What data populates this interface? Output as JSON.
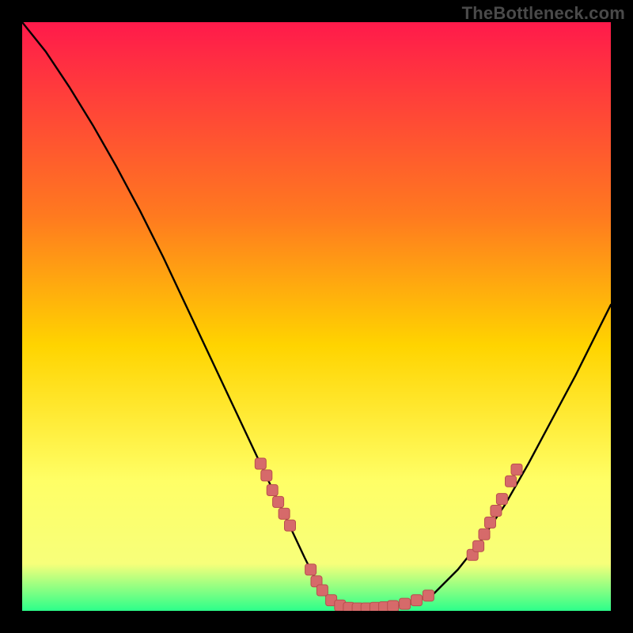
{
  "watermark": "TheBottleneck.com",
  "colors": {
    "gradient_top": "#ff1a4b",
    "gradient_mid_upper": "#ff7a1f",
    "gradient_mid": "#ffd400",
    "gradient_lower": "#f7ff7a",
    "gradient_bottom_yellow": "#ffff66",
    "gradient_bottom_green": "#2cff8a",
    "curve": "#000000",
    "marker_fill": "#d66a6a",
    "marker_stroke": "#b94e4e",
    "bg": "#000000"
  },
  "chart_data": {
    "type": "line",
    "title": "",
    "xlabel": "",
    "ylabel": "",
    "xlim": [
      0,
      100
    ],
    "ylim": [
      0,
      100
    ],
    "grid": false,
    "legend": false,
    "series": [
      {
        "name": "bottleneck-curve",
        "x": [
          0,
          4,
          8,
          12,
          16,
          20,
          24,
          28,
          32,
          36,
          40,
          44,
          48,
          50,
          52,
          54,
          56,
          58,
          62,
          66,
          70,
          74,
          78,
          82,
          86,
          90,
          94,
          98,
          100
        ],
        "y": [
          100,
          95,
          89,
          82.5,
          75.5,
          68,
          60,
          51.5,
          43,
          34.5,
          26,
          17.5,
          9,
          5,
          2,
          0.8,
          0.4,
          0.4,
          0.6,
          1.2,
          3,
          7,
          12,
          18,
          25,
          32.5,
          40,
          48,
          52
        ]
      }
    ],
    "markers": [
      {
        "name": "left-cluster",
        "points": [
          {
            "x": 40.5,
            "y": 25.0
          },
          {
            "x": 41.5,
            "y": 23.0
          },
          {
            "x": 42.5,
            "y": 20.5
          },
          {
            "x": 43.5,
            "y": 18.5
          },
          {
            "x": 44.5,
            "y": 16.5
          },
          {
            "x": 45.5,
            "y": 14.5
          }
        ]
      },
      {
        "name": "bottom-cluster",
        "points": [
          {
            "x": 49.0,
            "y": 7.0
          },
          {
            "x": 50.0,
            "y": 5.0
          },
          {
            "x": 51.0,
            "y": 3.5
          },
          {
            "x": 52.5,
            "y": 1.8
          },
          {
            "x": 54.0,
            "y": 0.9
          },
          {
            "x": 55.5,
            "y": 0.5
          },
          {
            "x": 57.0,
            "y": 0.4
          },
          {
            "x": 58.5,
            "y": 0.4
          },
          {
            "x": 60.0,
            "y": 0.5
          },
          {
            "x": 61.5,
            "y": 0.6
          },
          {
            "x": 63.0,
            "y": 0.8
          },
          {
            "x": 65.0,
            "y": 1.2
          },
          {
            "x": 67.0,
            "y": 1.8
          },
          {
            "x": 69.0,
            "y": 2.6
          }
        ]
      },
      {
        "name": "right-cluster",
        "points": [
          {
            "x": 76.5,
            "y": 9.5
          },
          {
            "x": 77.5,
            "y": 11.0
          },
          {
            "x": 78.5,
            "y": 13.0
          },
          {
            "x": 79.5,
            "y": 15.0
          },
          {
            "x": 80.5,
            "y": 17.0
          },
          {
            "x": 81.5,
            "y": 19.0
          },
          {
            "x": 83.0,
            "y": 22.0
          },
          {
            "x": 84.0,
            "y": 24.0
          }
        ]
      }
    ]
  }
}
